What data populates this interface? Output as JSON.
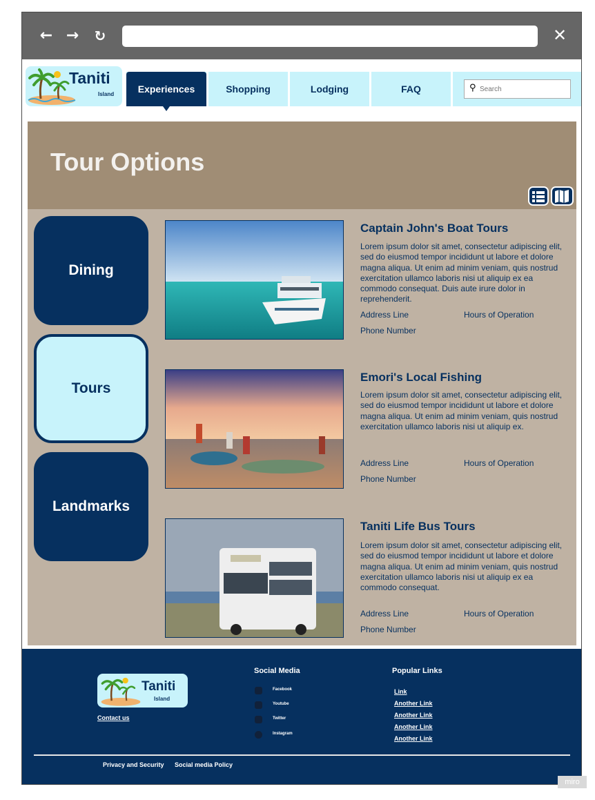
{
  "browser": {
    "back_icon": "arrow-left-icon",
    "forward_icon": "arrow-right-icon",
    "reload_icon": "reload-icon",
    "url": "",
    "close_icon": "close-icon"
  },
  "brand": {
    "name": "Taniti",
    "sub": "Island",
    "colors": {
      "primary": "#06305f",
      "light": "#c8f3fb",
      "hero": "#a08d75",
      "panel": "#bfb2a3"
    }
  },
  "nav": {
    "items": [
      {
        "label": "Experiences",
        "active": true
      },
      {
        "label": "Shopping",
        "active": false
      },
      {
        "label": "Lodging",
        "active": false
      },
      {
        "label": "FAQ",
        "active": false
      }
    ],
    "search_placeholder": "Search"
  },
  "hero": {
    "title": "Tour Options",
    "view_buttons": [
      "list-view-icon",
      "map-view-icon"
    ]
  },
  "categories": [
    {
      "label": "Dining",
      "active": false
    },
    {
      "label": "Tours",
      "active": true
    },
    {
      "label": "Landmarks",
      "active": false
    }
  ],
  "tours": [
    {
      "title": "Captain John's Boat Tours",
      "description": "Lorem ipsum dolor sit amet, consectetur adipiscing elit, sed do eiusmod tempor incididunt ut labore et dolore magna aliqua. Ut enim ad minim veniam, quis nostrud exercitation ullamco laboris nisi ut aliquip ex ea commodo consequat. Duis aute irure dolor in reprehenderit.",
      "address": "Address Line",
      "hours": "Hours of Operation",
      "phone": "Phone Number",
      "image": "boat-photo"
    },
    {
      "title": "Emori's Local Fishing",
      "description": "Lorem ipsum dolor sit amet, consectetur adipiscing elit, sed do eiusmod tempor incididunt ut labore et dolore magna aliqua. Ut enim ad minim veniam, quis nostrud exercitation ullamco laboris nisi ut aliquip ex.",
      "address": "Address Line",
      "hours": "Hours of Operation",
      "phone": "Phone Number",
      "image": "fishing-photo"
    },
    {
      "title": "Taniti Life Bus Tours",
      "description": "Lorem ipsum dolor sit amet, consectetur adipiscing elit, sed do eiusmod tempor incididunt ut labore et dolore magna aliqua. Ut enim ad minim veniam, quis nostrud exercitation ullamco laboris nisi ut aliquip ex ea commodo consequat.",
      "address": "Address Line",
      "hours": "Hours of Operation",
      "phone": "Phone Number",
      "image": "bus-photo"
    }
  ],
  "footer": {
    "logo_name": "Taniti",
    "logo_sub": "Island",
    "contact": "Contact us",
    "social_heading": "Social Media",
    "social": [
      {
        "label": "Facebook",
        "icon": "facebook-icon"
      },
      {
        "label": "Youtube",
        "icon": "youtube-icon"
      },
      {
        "label": "Twitter",
        "icon": "twitter-icon"
      },
      {
        "label": "Instagram",
        "icon": "instagram-icon"
      }
    ],
    "links_heading": "Popular Links",
    "links": [
      "Link",
      "Another Link",
      "Another Link",
      "Another Link",
      "Another Link"
    ],
    "privacy": "Privacy and Security",
    "social_policy": "Social media Policy"
  },
  "watermark": "miro"
}
